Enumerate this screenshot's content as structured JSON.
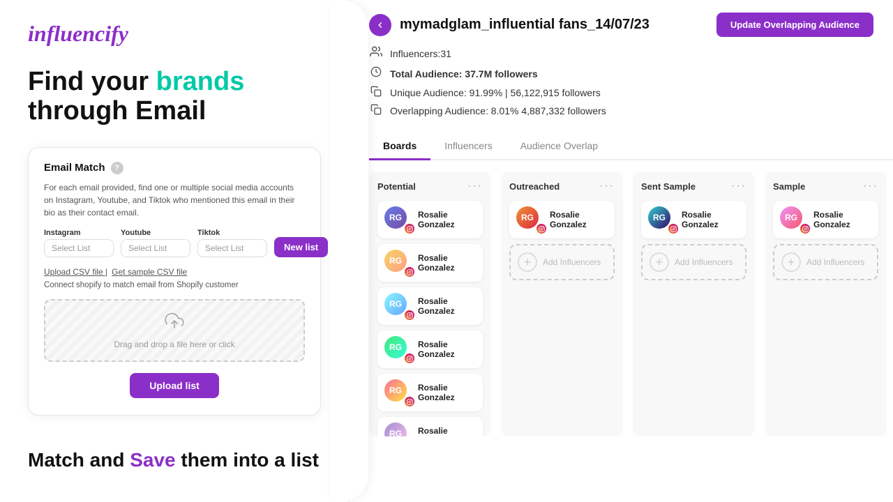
{
  "left": {
    "logo": "influencify",
    "headline_part1": "Find your ",
    "headline_accent": "brands",
    "headline_part2": " through Email",
    "card": {
      "title": "Email Match",
      "description": "For each email provided, find one or multiple social media accounts on Instagram, Youtube, and Tiktok who mentioned this email in their bio as their contact email.",
      "instagram_label": "Instagram",
      "instagram_placeholder": "Select List",
      "youtube_label": "Youtube",
      "youtube_placeholder": "Select List",
      "tiktok_label": "Tiktok",
      "tiktok_placeholder": "Select List",
      "new_list_btn": "New list",
      "upload_csv_label": "Upload CSV file |",
      "sample_csv_label": "Get sample CSV file",
      "shopify_text": "Connect shopify to match email from Shopify customer",
      "upload_zone_text": "Drag and drop a file here or click",
      "upload_btn": "Upload list"
    },
    "bottom_headline_part1": "Match and ",
    "bottom_headline_accent": "Save",
    "bottom_headline_part2": " them into a list"
  },
  "right": {
    "campaign_title": "mymadglam_influential fans_14/07/23",
    "update_btn": "Update Overlapping Audience",
    "stats": {
      "influencers_label": "Influencers:",
      "influencers_count": "31",
      "total_audience_label": "Total Audience:",
      "total_audience_value": "37.7M followers",
      "unique_label": "Unique Audience:",
      "unique_value": "91.99% | 56,122,915 followers",
      "overlapping_label": "Overlapping Audience:",
      "overlapping_value": "8.01%  4,887,332 followers"
    },
    "tabs": [
      {
        "label": "Boards",
        "active": true
      },
      {
        "label": "Influencers",
        "active": false
      },
      {
        "label": "Audience Overlap",
        "active": false
      }
    ],
    "boards": [
      {
        "title": "Potential",
        "influencers": [
          {
            "name": "Rosalie Gonzalez"
          },
          {
            "name": "Rosalie Gonzalez"
          },
          {
            "name": "Rosalie Gonzalez"
          },
          {
            "name": "Rosalie Gonzalez"
          },
          {
            "name": "Rosalie Gonzalez"
          },
          {
            "name": "Rosalie Gonzalez"
          }
        ],
        "add_label": null
      },
      {
        "title": "Outreached",
        "influencers": [
          {
            "name": "Rosalie Gonzalez"
          }
        ],
        "add_label": "Add Influencers"
      },
      {
        "title": "Sent Sample",
        "influencers": [
          {
            "name": "Rosalie Gonzalez"
          }
        ],
        "add_label": "Add Influencers"
      },
      {
        "title": "Sample",
        "influencers": [
          {
            "name": "Rosalie Gonzalez"
          }
        ],
        "add_label": "Add Influencers"
      }
    ]
  }
}
